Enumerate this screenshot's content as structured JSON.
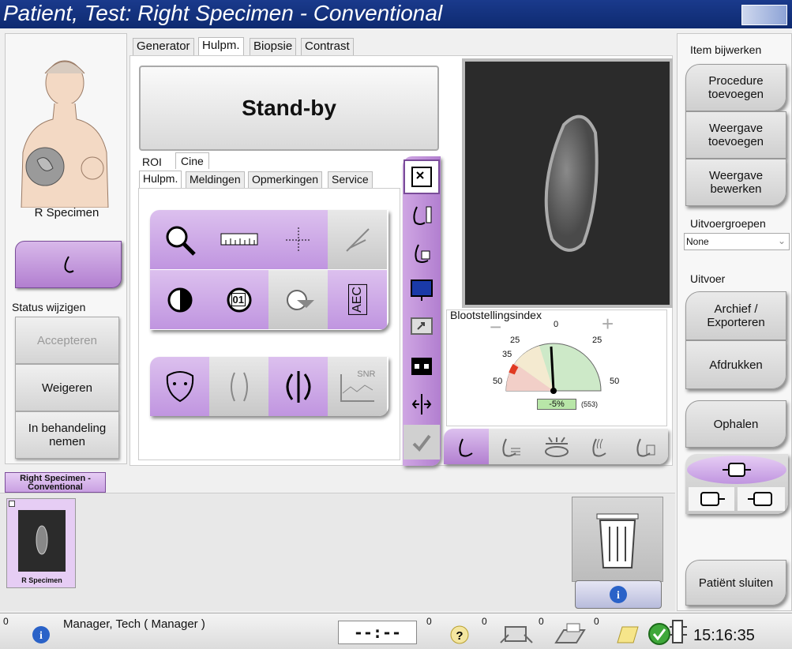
{
  "window": {
    "title": "Patient, Test:  Right Specimen - Conventional"
  },
  "left": {
    "thumbnail_label": "R Specimen",
    "status_group_label": "Status wijzigen",
    "accept": "Accepteren",
    "reject": "Weigeren",
    "in_progress": "In behandeling nemen"
  },
  "main_tabs": [
    "Generator",
    "Hulpm.",
    "Biopsie",
    "Contrast"
  ],
  "standby": "Stand-by",
  "sub_tabs_top": [
    "ROI",
    "Cine"
  ],
  "sub_tabs": [
    "Hulpm.",
    "Meldingen",
    "Opmerkingen",
    "Service"
  ],
  "tool_badge_01": "01",
  "tool_aec": "AEC",
  "tool_snr": "SNR",
  "exposure": {
    "title": "Blootstellingsindex",
    "ticks": [
      "0",
      "25",
      "25",
      "35",
      "50",
      "50"
    ],
    "percent": "-5%",
    "value": "(553)",
    "minus": "−",
    "plus": "+"
  },
  "right": {
    "section_title": "Item bijwerken",
    "add_procedure": "Procedure toevoegen",
    "add_view": "Weergave toevoegen",
    "edit_view": "Weergave bewerken",
    "output_groups_label": "Uitvoergroepen",
    "output_groups_value": "None",
    "output_label": "Uitvoer",
    "archive": "Archief / Exporteren",
    "print": "Afdrukken",
    "retrieve": "Ophalen",
    "close_patient": "Patiënt sluiten"
  },
  "bottom": {
    "procedure_tab": "Right Specimen - Conventional",
    "thumb_label": "R Specimen"
  },
  "statusbar": {
    "count0": "0",
    "user": "Manager, Tech ( Manager )",
    "timer": "--:--",
    "count1": "0",
    "count2": "0",
    "count3": "0",
    "count4": "0",
    "time": "15:16:35"
  },
  "colors": {
    "accent": "#b27fd0",
    "title_bar": "#1a3a8c"
  }
}
